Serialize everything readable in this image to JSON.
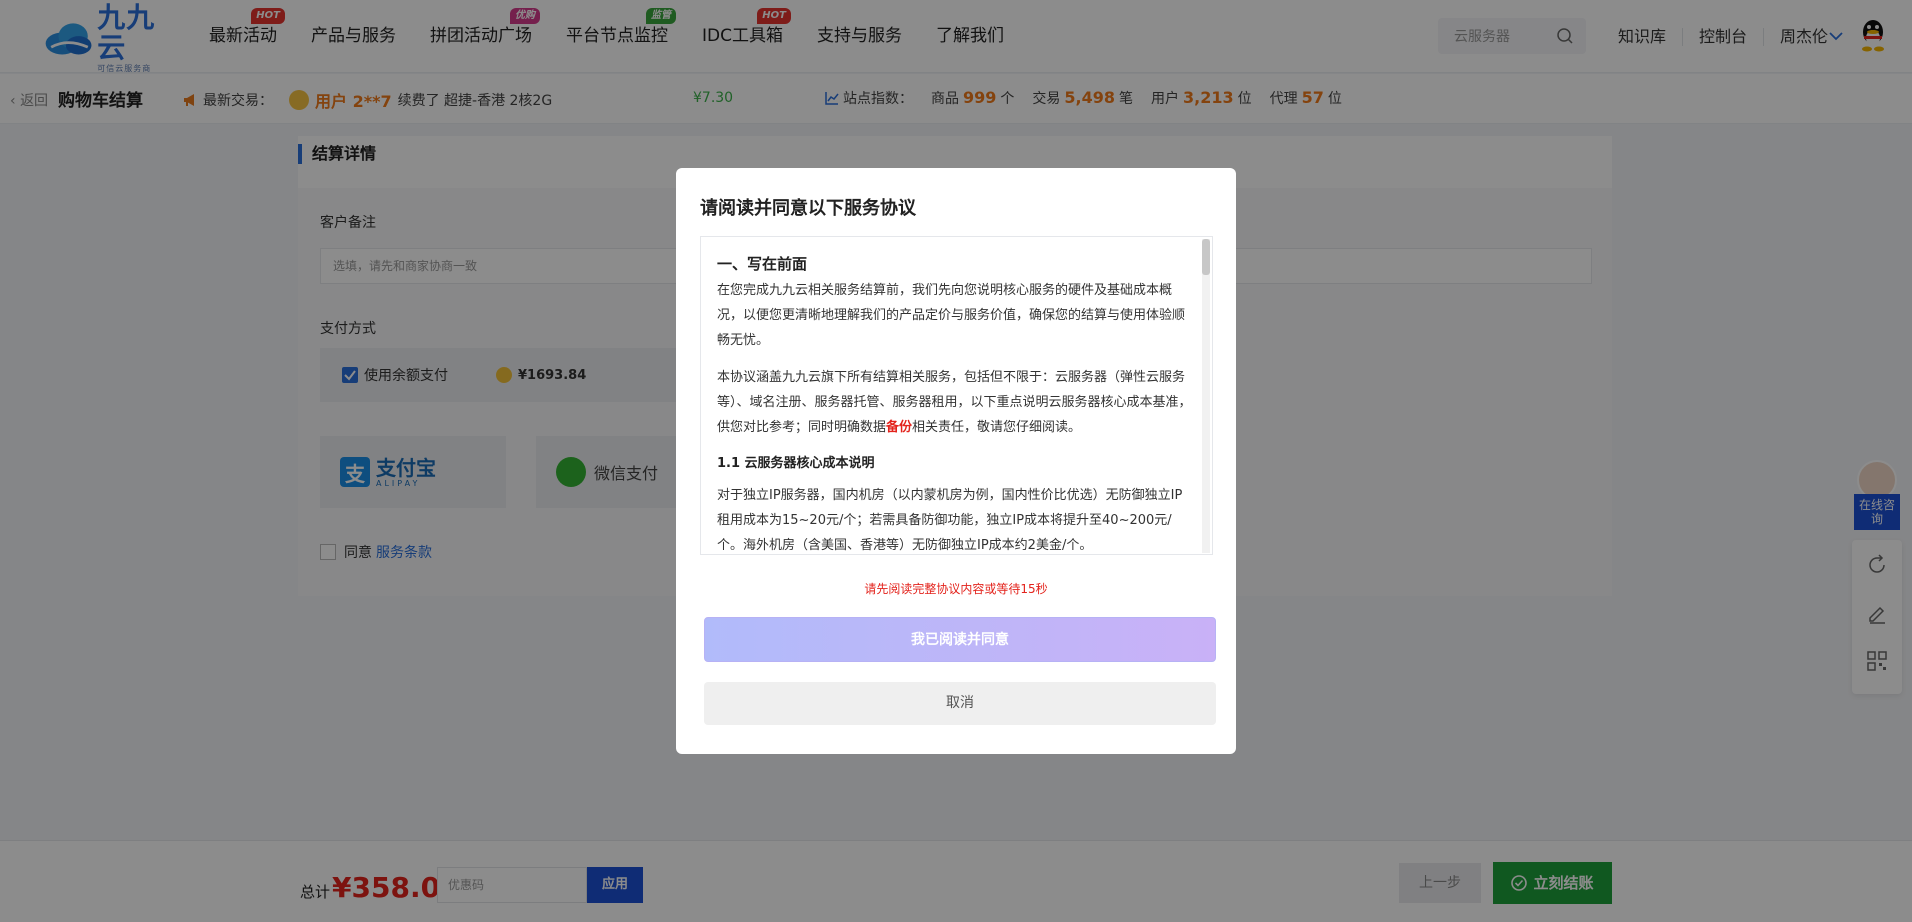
{
  "header": {
    "logo_name": "九九云",
    "logo_sub": "可信云服务商",
    "nav": [
      {
        "label": "最新活动",
        "tag": "HOT",
        "tag_color": "#e5332f"
      },
      {
        "label": "产品与服务",
        "tag": "",
        "tag_color": ""
      },
      {
        "label": "拼团活动广场",
        "tag": "优购",
        "tag_color": "#d53b8c"
      },
      {
        "label": "平台节点监控",
        "tag": "监管",
        "tag_color": "#3aa63d"
      },
      {
        "label": "IDC工具箱",
        "tag": "HOT",
        "tag_color": "#e5332f"
      },
      {
        "label": "支持与服务",
        "tag": "",
        "tag_color": ""
      },
      {
        "label": "了解我们",
        "tag": "",
        "tag_color": ""
      }
    ],
    "search_placeholder": "云服务器",
    "links": [
      "知识库",
      "控制台",
      "周杰伦"
    ]
  },
  "subbar": {
    "back_label": "返回",
    "title": "购物车结算",
    "trade_label": "最新交易：",
    "trade_user": "用户 2**7",
    "trade_action": "续费了 超捷-香港 2核2G",
    "trade_price": "¥7.30",
    "stats_label": "站点指数：",
    "stats": [
      {
        "pre": "商品",
        "num": "999",
        "unit": "个"
      },
      {
        "pre": "交易",
        "num": "5,498",
        "unit": "笔"
      },
      {
        "pre": "用户",
        "num": "3,213",
        "unit": "位"
      },
      {
        "pre": "代理",
        "num": "57",
        "unit": "位"
      }
    ]
  },
  "checkout": {
    "section_title": "结算详情",
    "note_label": "客户备注",
    "note_placeholder": "选填，请先和商家协商一致",
    "payment_label": "支付方式",
    "balance_label": "使用余额支付",
    "balance_amount": "¥1693.84",
    "alipay_cn": "支付宝",
    "alipay_en": "ALIPAY",
    "wechat_label": "微信支付",
    "agree_text": "同意",
    "agree_link": "服务条款"
  },
  "bottom": {
    "total_label": "总计",
    "total_amount": "¥358.00",
    "coupon_placeholder": "优惠码",
    "apply_label": "应用",
    "prev_label": "上一步",
    "pay_label": "立刻结账"
  },
  "float": {
    "chat_label": "在线咨询"
  },
  "modal": {
    "title": "请阅读并同意以下服务协议",
    "section1_title": "一、写在前面",
    "para1": "在您完成九九云相关服务结算前，我们先向您说明核心服务的硬件及基础成本概况，以便您更清晰地理解我们的产品定价与服务价值，确保您的结算与使用体验顺畅无忧。",
    "para2_a": "本协议涵盖九九云旗下所有结算相关服务，包括但不限于：云服务器（弹性云服务等）、域名注册、服务器托管、服务器租用，以下重点说明云服务器核心成本基准，供您对比参考；同时明确数据",
    "para2_hl": "备份",
    "para2_b": "相关责任，敬请您仔细阅读。",
    "sub1_title": "1.1 云服务器核心成本说明",
    "para3": "对于独立IP服务器，国内机房（以内蒙机房为例，国内性价比优选）无防御独立IP租用成本为15~20元/个；若需具备防御功能，独立IP成本将提升至40~200元/个。海外机房（含美国、香港等）无防御独立IP成本约2美金/个。",
    "wait_msg": "请先阅读完整协议内容或等待15秒",
    "agree_btn": "我已阅读并同意",
    "cancel_btn": "取消"
  },
  "colors": {
    "brand": "#2a6fdb",
    "accent_orange": "#f07a1a",
    "price_red": "#e3231c",
    "pay_green": "#1ea13b"
  }
}
